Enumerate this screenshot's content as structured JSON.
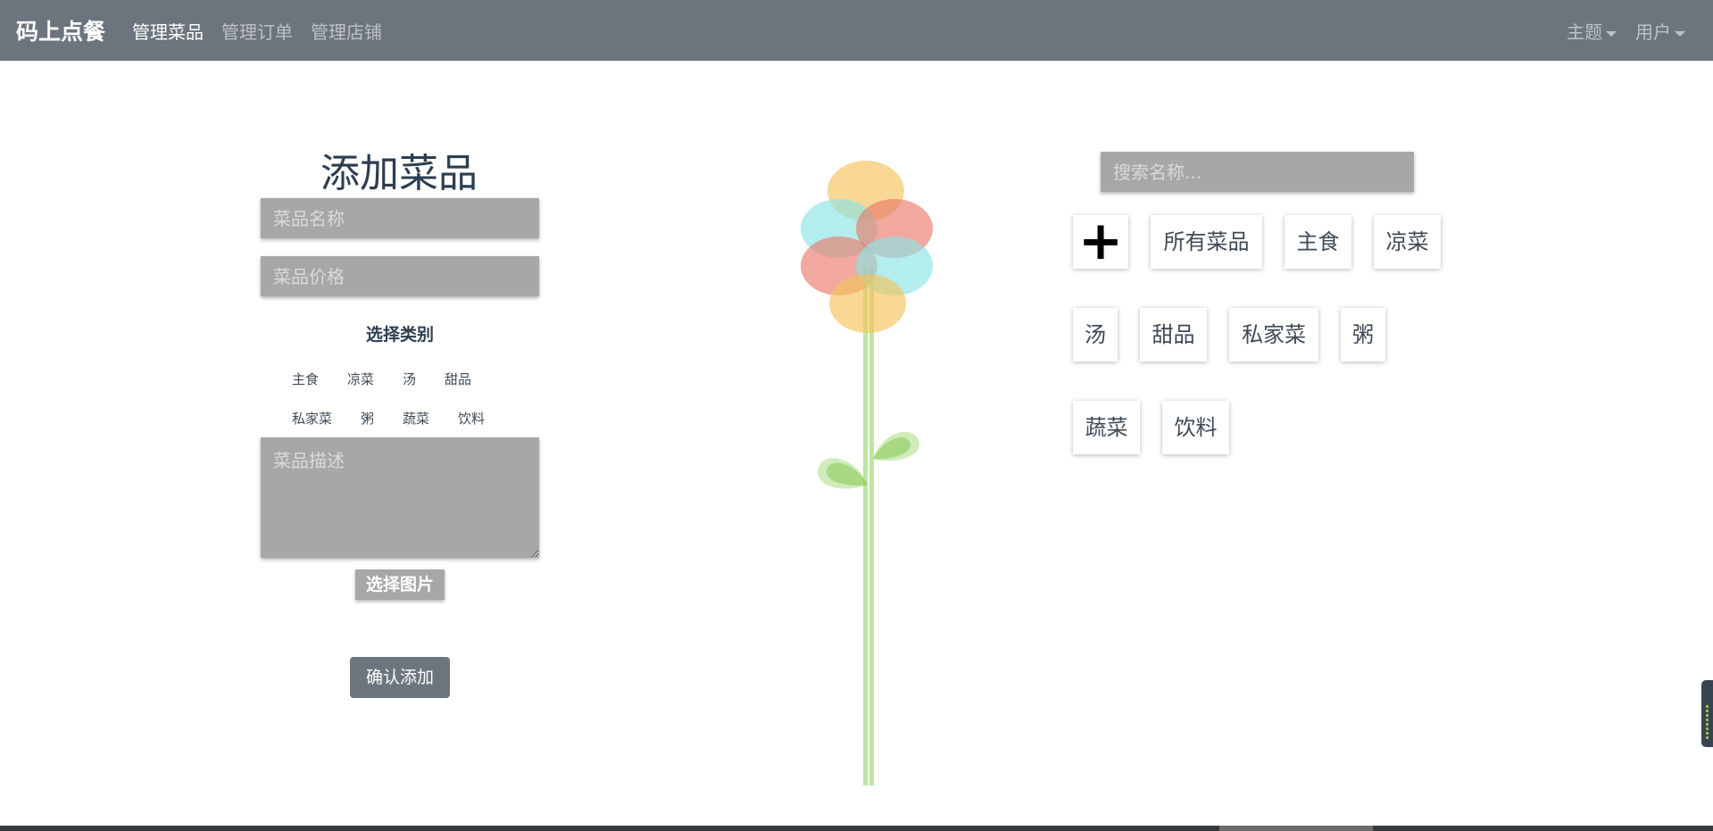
{
  "nav": {
    "brand": "码上点餐",
    "links": [
      "管理菜品",
      "管理订单",
      "管理店铺"
    ],
    "active_index": 0,
    "theme_label": "主题",
    "user_label": "用户"
  },
  "form": {
    "title": "添加菜品",
    "name_placeholder": "菜品名称",
    "price_placeholder": "菜品价格",
    "category_title": "选择类别",
    "categories": [
      "主食",
      "凉菜",
      "汤",
      "甜品",
      "私家菜",
      "粥",
      "蔬菜",
      "饮料"
    ],
    "description_placeholder": "菜品描述",
    "pick_image_label": "选择图片",
    "confirm_label": "确认添加"
  },
  "filter": {
    "search_placeholder": "搜索名称...",
    "add_symbol": "+",
    "tiles": [
      "所有菜品",
      "主食",
      "凉菜",
      "汤",
      "甜品",
      "私家菜",
      "粥",
      "蔬菜",
      "饮料"
    ]
  },
  "colors": {
    "navbar": "#6c757d",
    "input_bg": "#a6a7a9",
    "petal_orange": "#f5c35a",
    "petal_red": "#ea7b6b",
    "petal_cyan": "#8ae3e3",
    "leaf_green": "#8ccd5a"
  }
}
